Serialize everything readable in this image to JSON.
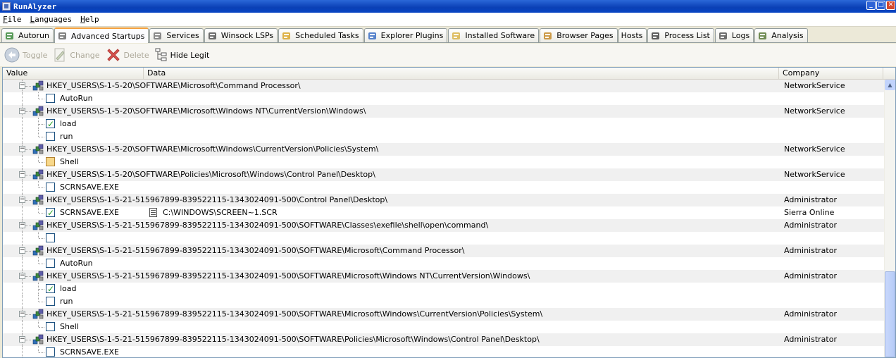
{
  "window": {
    "title": "RunAlyzer",
    "buttons": [
      "_",
      "□",
      "✕"
    ]
  },
  "menu": [
    "File",
    "Languages",
    "Help"
  ],
  "tabs": [
    {
      "label": "Autorun",
      "icon": "autorun-icon",
      "active": false
    },
    {
      "label": "Advanced Startups",
      "icon": "advanced-startups-icon",
      "active": true
    },
    {
      "label": "Services",
      "icon": "services-icon",
      "active": false
    },
    {
      "label": "Winsock LSPs",
      "icon": "winsock-icon",
      "active": false
    },
    {
      "label": "Scheduled Tasks",
      "icon": "scheduled-tasks-icon",
      "active": false
    },
    {
      "label": "Explorer Plugins",
      "icon": "explorer-plugins-icon",
      "active": false
    },
    {
      "label": "Installed Software",
      "icon": "installed-software-icon",
      "active": false
    },
    {
      "label": "Browser Pages",
      "icon": "browser-pages-icon",
      "active": false
    },
    {
      "label": "Hosts",
      "icon": "",
      "active": false
    },
    {
      "label": "Process List",
      "icon": "process-list-icon",
      "active": false
    },
    {
      "label": "Logs",
      "icon": "logs-icon",
      "active": false
    },
    {
      "label": "Analysis",
      "icon": "analysis-icon",
      "active": false
    }
  ],
  "toolbar": {
    "toggle": "Toggle",
    "change": "Change",
    "delete": "Delete",
    "hide_legit": "Hide Legit"
  },
  "columns": {
    "value": "Value",
    "data": "Data",
    "company": "Company"
  },
  "rows": [
    {
      "type": "group",
      "key": "HKEY_USERS\\S-1-5-20\\SOFTWARE\\Microsoft\\Command Processor\\",
      "company": "NetworkService"
    },
    {
      "type": "item",
      "checked": "unchecked",
      "value": "AutoRun",
      "data": "",
      "company": "",
      "last": true
    },
    {
      "type": "group",
      "key": "HKEY_USERS\\S-1-5-20\\SOFTWARE\\Microsoft\\Windows NT\\CurrentVersion\\Windows\\",
      "company": "NetworkService"
    },
    {
      "type": "item",
      "checked": "checked",
      "value": "load",
      "data": "",
      "company": "",
      "last": false
    },
    {
      "type": "item",
      "checked": "unchecked",
      "value": "run",
      "data": "",
      "company": "",
      "last": true
    },
    {
      "type": "group",
      "key": "HKEY_USERS\\S-1-5-20\\SOFTWARE\\Microsoft\\Windows\\CurrentVersion\\Policies\\System\\",
      "company": "NetworkService"
    },
    {
      "type": "item",
      "checked": "partial",
      "value": "Shell",
      "data": "",
      "company": "",
      "last": true
    },
    {
      "type": "group",
      "key": "HKEY_USERS\\S-1-5-20\\SOFTWARE\\Policies\\Microsoft\\Windows\\Control Panel\\Desktop\\",
      "company": "NetworkService"
    },
    {
      "type": "item",
      "checked": "unchecked",
      "value": "SCRNSAVE.EXE",
      "data": "",
      "company": "",
      "last": true
    },
    {
      "type": "group",
      "key": "HKEY_USERS\\S-1-5-21-515967899-839522115-1343024091-500\\Control Panel\\Desktop\\",
      "company": "Administrator"
    },
    {
      "type": "item",
      "checked": "checked",
      "value": "SCRNSAVE.EXE",
      "data": "C:\\WINDOWS\\SCREEN~1.SCR",
      "company": "Sierra Online",
      "last": true
    },
    {
      "type": "group",
      "key": "HKEY_USERS\\S-1-5-21-515967899-839522115-1343024091-500\\SOFTWARE\\Classes\\exefile\\shell\\open\\command\\",
      "company": "Administrator"
    },
    {
      "type": "item",
      "checked": "unchecked",
      "value": "",
      "data": "",
      "company": "",
      "last": true
    },
    {
      "type": "group",
      "key": "HKEY_USERS\\S-1-5-21-515967899-839522115-1343024091-500\\SOFTWARE\\Microsoft\\Command Processor\\",
      "company": "Administrator"
    },
    {
      "type": "item",
      "checked": "unchecked",
      "value": "AutoRun",
      "data": "",
      "company": "",
      "last": true
    },
    {
      "type": "group",
      "key": "HKEY_USERS\\S-1-5-21-515967899-839522115-1343024091-500\\SOFTWARE\\Microsoft\\Windows NT\\CurrentVersion\\Windows\\",
      "company": "Administrator"
    },
    {
      "type": "item",
      "checked": "checked",
      "value": "load",
      "data": "",
      "company": "",
      "last": false
    },
    {
      "type": "item",
      "checked": "unchecked",
      "value": "run",
      "data": "",
      "company": "",
      "last": true
    },
    {
      "type": "group",
      "key": "HKEY_USERS\\S-1-5-21-515967899-839522115-1343024091-500\\SOFTWARE\\Microsoft\\Windows\\CurrentVersion\\Policies\\System\\",
      "company": "Administrator"
    },
    {
      "type": "item",
      "checked": "unchecked",
      "value": "Shell",
      "data": "",
      "company": "",
      "last": true
    },
    {
      "type": "group",
      "key": "HKEY_USERS\\S-1-5-21-515967899-839522115-1343024091-500\\SOFTWARE\\Policies\\Microsoft\\Windows\\Control Panel\\Desktop\\",
      "company": "Administrator"
    },
    {
      "type": "item",
      "checked": "unchecked",
      "value": "SCRNSAVE.EXE",
      "data": "",
      "company": "",
      "last": true
    }
  ]
}
